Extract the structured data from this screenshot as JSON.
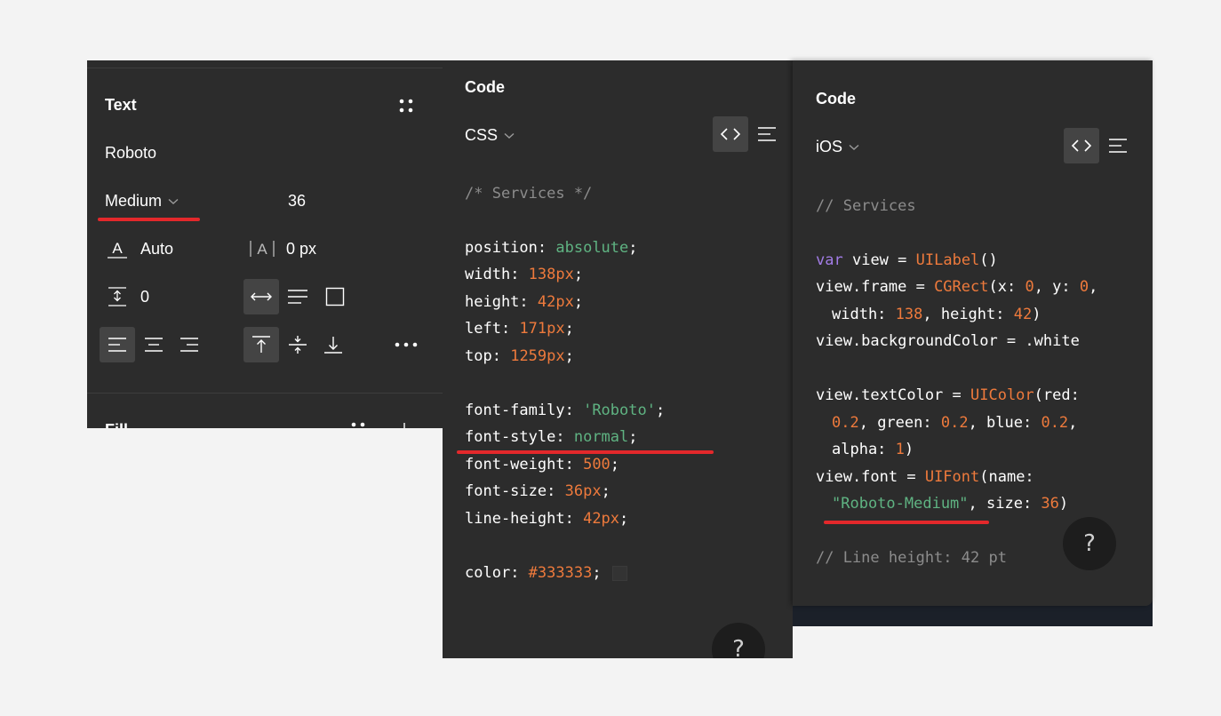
{
  "text_panel": {
    "title": "Text",
    "font_family": "Roboto",
    "weight": "Medium",
    "size": "36",
    "line_height": "Auto",
    "letter_spacing": "0 px",
    "paragraph_spacing": "0",
    "next_section": "Fill"
  },
  "css_panel": {
    "header": "Code",
    "language": "CSS",
    "comment": "/* Services */",
    "properties": [
      {
        "key": "position",
        "value": "absolute"
      },
      {
        "key": "width",
        "value": "138px"
      },
      {
        "key": "height",
        "value": "42px"
      },
      {
        "key": "left",
        "value": "171px"
      },
      {
        "key": "top",
        "value": "1259px"
      },
      {
        "key": "font-family",
        "value": "'Roboto'"
      },
      {
        "key": "font-style",
        "value": "normal"
      },
      {
        "key": "font-weight",
        "value": "500"
      },
      {
        "key": "font-size",
        "value": "36px"
      },
      {
        "key": "line-height",
        "value": "42px"
      },
      {
        "key": "color",
        "value": "#333333"
      }
    ],
    "help": "?"
  },
  "ios_panel": {
    "header": "Code",
    "language": "iOS",
    "comment": "// Services",
    "kw_var": "var",
    "view": "view",
    "eq": " = ",
    "uilabel": "UILabel",
    "parens": "()",
    "frame_prefix": "view.frame = ",
    "cgrect": "CGRect",
    "x_label": "(x: ",
    "x_val": "0",
    "y_label": ", y: ",
    "y_val": "0",
    "comma": ",",
    "width_label": "width: ",
    "width_val": "138",
    "height_label": ", height: ",
    "height_val": "42",
    "close": ")",
    "bg_line": "view.backgroundColor = .white",
    "textcolor_prefix": "view.textColor = ",
    "uicolor": "UIColor",
    "red_label": "(red:",
    "red_val": "0.2",
    "green_label": ", green: ",
    "green_val": "0.2",
    "blue_label": ", blue: ",
    "blue_val": "0.2",
    "alpha_label": "alpha: ",
    "alpha_val": "1",
    "font_prefix": "view.font = ",
    "uifont": "UIFont",
    "name_label": "(name:",
    "font_name": "\"Roboto-Medium\"",
    "size_label": ", size: ",
    "size_val": "36",
    "line_height_comment": "// Line height: 42 pt",
    "help": "?"
  },
  "colors": {
    "panel_bg": "#2c2c2c",
    "page_bg": "#f3f3f3",
    "string_green": "#5fb382",
    "number_orange": "#ee7a3c",
    "keyword_purple": "#a27ce6",
    "comment_gray": "#8c8c8c",
    "highlight_red": "#e3282b",
    "swatch": "#333333"
  }
}
